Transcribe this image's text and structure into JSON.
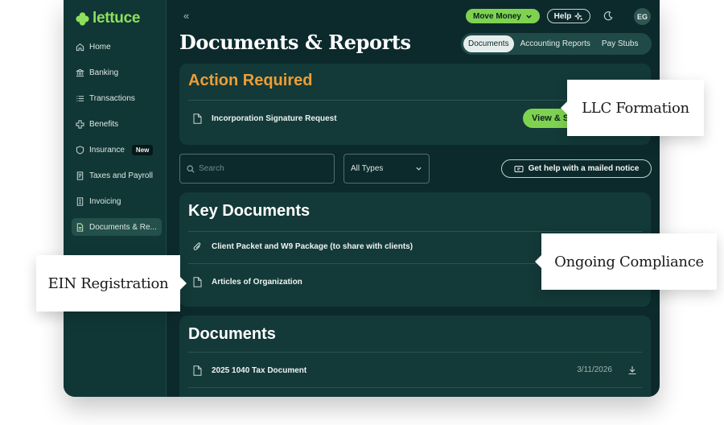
{
  "brand": {
    "name": "lettuce",
    "color": "#8ee05c"
  },
  "sidebar": {
    "items": [
      {
        "label": "Home",
        "icon": "home-icon"
      },
      {
        "label": "Banking",
        "icon": "bank-icon"
      },
      {
        "label": "Transactions",
        "icon": "list-icon"
      },
      {
        "label": "Benefits",
        "icon": "plus-cross-icon"
      },
      {
        "label": "Insurance",
        "icon": "shield-icon",
        "badge": "New"
      },
      {
        "label": "Taxes and Payroll",
        "icon": "receipt-icon"
      },
      {
        "label": "Invoicing",
        "icon": "invoice-icon"
      },
      {
        "label": "Documents & Re...",
        "icon": "document-icon",
        "active": true
      }
    ]
  },
  "topbar": {
    "move_money": "Move Money",
    "help": "Help",
    "avatar_initials": "EG"
  },
  "page": {
    "title": "Documents & Reports",
    "tabs": [
      {
        "label": "Documents",
        "active": true
      },
      {
        "label": "Accounting Reports"
      },
      {
        "label": "Pay Stubs"
      }
    ]
  },
  "action_required": {
    "title": "Action Required",
    "item": "Incorporation Signature Request",
    "button": "View & Sign"
  },
  "filters": {
    "search_placeholder": "Search",
    "type_select": "All Types",
    "mail_help": "Get help with a mailed notice"
  },
  "key_documents": {
    "title": "Key Documents",
    "items": [
      {
        "label": "Client Packet and W9 Package (to share with clients)",
        "icon": "paperclip-icon"
      },
      {
        "label": "Articles of Organization",
        "icon": "document-icon"
      }
    ]
  },
  "documents": {
    "title": "Documents",
    "items": [
      {
        "label": "2025 1040 Tax Document",
        "date": "3/11/2026"
      }
    ]
  },
  "callouts": {
    "llc": "LLC Formation",
    "ongoing": "Ongoing Compliance",
    "ein": "EIN Registration"
  },
  "colors": {
    "background": "#0c2a2c",
    "sidebar": "#103735",
    "card": "#133a38",
    "accent_green": "#7fd24f",
    "action_orange": "#ee9d36"
  }
}
